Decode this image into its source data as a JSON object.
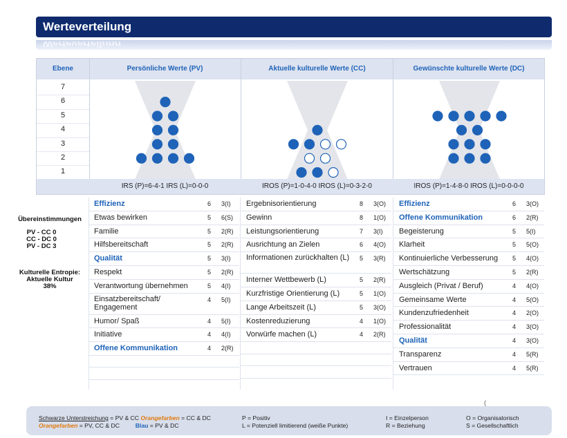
{
  "header": {
    "title": "Werteverteilung"
  },
  "columns": {
    "ebene": "Ebene",
    "pv": "Persönliche Werte (PV)",
    "cc": "Aktuelle kulturelle Werte (CC)",
    "dc": "Gewünschte kulturelle Werte (DC)"
  },
  "levels": [
    "7",
    "6",
    "5",
    "4",
    "3",
    "2",
    "1"
  ],
  "footer": {
    "pv": "IRS (P)=6-4-1  IRS (L)=0-0-0",
    "cc": "IROS (P)=1-0-4-0  IROS (L)=0-3-2-0",
    "dc": "IROS (P)=1-4-8-0  IROS (L)=0-0-0-0"
  },
  "distribution": {
    "pv": [
      [
        6,
        1,
        0
      ],
      [
        5,
        2,
        0
      ],
      [
        4,
        2,
        0
      ],
      [
        3,
        2,
        0
      ],
      [
        2,
        4,
        0
      ]
    ],
    "cc": [
      [
        4,
        1,
        0
      ],
      [
        3,
        2,
        2
      ],
      [
        2,
        0,
        2
      ],
      [
        1,
        2,
        1
      ]
    ],
    "dc": [
      [
        5,
        5,
        0
      ],
      [
        4,
        2,
        0
      ],
      [
        3,
        3,
        0
      ],
      [
        2,
        3,
        0
      ]
    ]
  },
  "side": {
    "matches_title": "Übereinstimmungen",
    "pv_cc": "PV - CC 0",
    "cc_dc": "CC - DC 0",
    "pv_dc": "PV - DC 3",
    "entropy_title": "Kulturelle Entropie:",
    "entropy_sub": "Aktuelle Kultur",
    "entropy_value": "38%"
  },
  "lists": {
    "pv": [
      {
        "label": "Effizienz",
        "score": "6",
        "code": "3(I)",
        "blue": true
      },
      {
        "label": "Etwas bewirken",
        "score": "5",
        "code": "6(S)"
      },
      {
        "label": "Familie",
        "score": "5",
        "code": "2(R)"
      },
      {
        "label": "Hilfsbereitschaft",
        "score": "5",
        "code": "2(R)"
      },
      {
        "label": "Qualität",
        "score": "5",
        "code": "3(I)",
        "blue": true
      },
      {
        "label": "Respekt",
        "score": "5",
        "code": "2(R)"
      },
      {
        "label": "Verantwortung übernehmen",
        "score": "5",
        "code": "4(I)"
      },
      {
        "label": "Einsatzbereitschaft/ Engagement",
        "score": "4",
        "code": "5(I)",
        "two": true
      },
      {
        "label": "Humor/ Spaß",
        "score": "4",
        "code": "5(I)"
      },
      {
        "label": "Initiative",
        "score": "4",
        "code": "4(I)"
      },
      {
        "label": "Offene Kommunikation",
        "score": "4",
        "code": "2(R)",
        "blue": true
      }
    ],
    "cc": [
      {
        "label": "Ergebnisorientierung",
        "score": "8",
        "code": "3(O)"
      },
      {
        "label": "Gewinn",
        "score": "8",
        "code": "1(O)"
      },
      {
        "label": "Leistungsorientierung",
        "score": "7",
        "code": "3(I)"
      },
      {
        "label": "Ausrichtung an Zielen",
        "score": "6",
        "code": "4(O)"
      },
      {
        "label": "Informationen zurückhalten (L)",
        "score": "5",
        "code": "3(R)",
        "two": true
      },
      {
        "label": "Interner Wettbewerb (L)",
        "score": "5",
        "code": "2(R)"
      },
      {
        "label": "Kurzfristige Orientierung (L)",
        "score": "5",
        "code": "1(O)"
      },
      {
        "label": "Lange Arbeitszeit (L)",
        "score": "5",
        "code": "3(O)"
      },
      {
        "label": "Kostenreduzierung",
        "score": "4",
        "code": "1(O)"
      },
      {
        "label": "Vorwürfe machen (L)",
        "score": "4",
        "code": "2(R)"
      }
    ],
    "dc": [
      {
        "label": "Effizienz",
        "score": "6",
        "code": "3(O)",
        "blue": true
      },
      {
        "label": "Offene Kommunikation",
        "score": "6",
        "code": "2(R)",
        "blue": true
      },
      {
        "label": "Begeisterung",
        "score": "5",
        "code": "5(I)"
      },
      {
        "label": "Klarheit",
        "score": "5",
        "code": "5(O)"
      },
      {
        "label": "Kontinuierliche Verbesserung",
        "score": "5",
        "code": "4(O)"
      },
      {
        "label": "Wertschätzung",
        "score": "5",
        "code": "2(R)"
      },
      {
        "label": "Ausgleich (Privat / Beruf)",
        "score": "4",
        "code": "4(O)"
      },
      {
        "label": "Gemeinsame Werte",
        "score": "4",
        "code": "5(O)"
      },
      {
        "label": "Kundenzufriedenheit",
        "score": "4",
        "code": "2(O)"
      },
      {
        "label": "Professionalität",
        "score": "4",
        "code": "3(O)"
      },
      {
        "label": "Qualität",
        "score": "4",
        "code": "3(O)",
        "blue": true
      },
      {
        "label": "Transparenz",
        "score": "4",
        "code": "5(R)"
      },
      {
        "label": "Vertrauen",
        "score": "4",
        "code": "5(R)"
      }
    ]
  },
  "legend": {
    "underline": "Schwarze Unterstreichung",
    "underline_rest": " = PV & CC ",
    "orange1": "Orangefarben",
    "orange1_rest": " = CC & DC",
    "orange2": "Orangefarben",
    "orange2_rest": " = PV, CC & DC",
    "blue": "Blau",
    "blue_rest": " = PV & DC",
    "p": "P = Positiv",
    "l": "L = Potenziell limitierend (weiße Punkte)",
    "i": "I = Einzelperson",
    "r": "R = Beziehung",
    "o": "O = Organisatorisch",
    "s": "S = Gesellschaftlich"
  },
  "colors": {
    "title_bg": "#0f2b6e",
    "accent": "#1f63b8",
    "dot": "#1f63b8",
    "header_bg": "#dde3f0"
  }
}
